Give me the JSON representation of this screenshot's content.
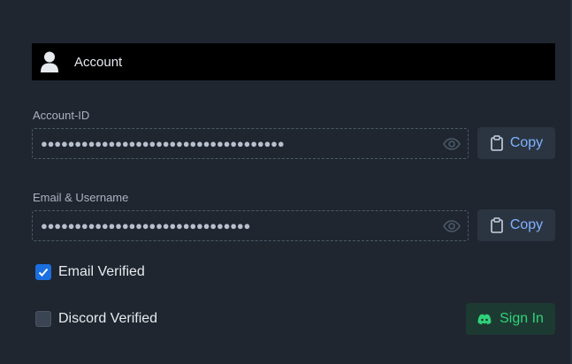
{
  "header": {
    "title": "Account",
    "icon": "user-icon"
  },
  "account_id": {
    "label": "Account-ID",
    "masked_value": "●●●●●●●●●●●●●●●●●●●●●●●●●●●●●●●●●●●●",
    "copy_label": "Copy"
  },
  "email": {
    "label": "Email & Username",
    "masked_value": "●●●●●●●●●●●●●●●●●●●●●●●●●●●●●●●",
    "copy_label": "Copy"
  },
  "email_verified": {
    "label": "Email Verified",
    "checked": true
  },
  "discord_verified": {
    "label": "Discord Verified",
    "checked": false
  },
  "discord_signin": {
    "label": "Sign In",
    "icon": "discord-icon"
  },
  "colors": {
    "background": "#1f2630",
    "accent_blue": "#7fb2ff",
    "checkbox_blue": "#1b6fe0",
    "discord_green": "#2fd37a"
  }
}
